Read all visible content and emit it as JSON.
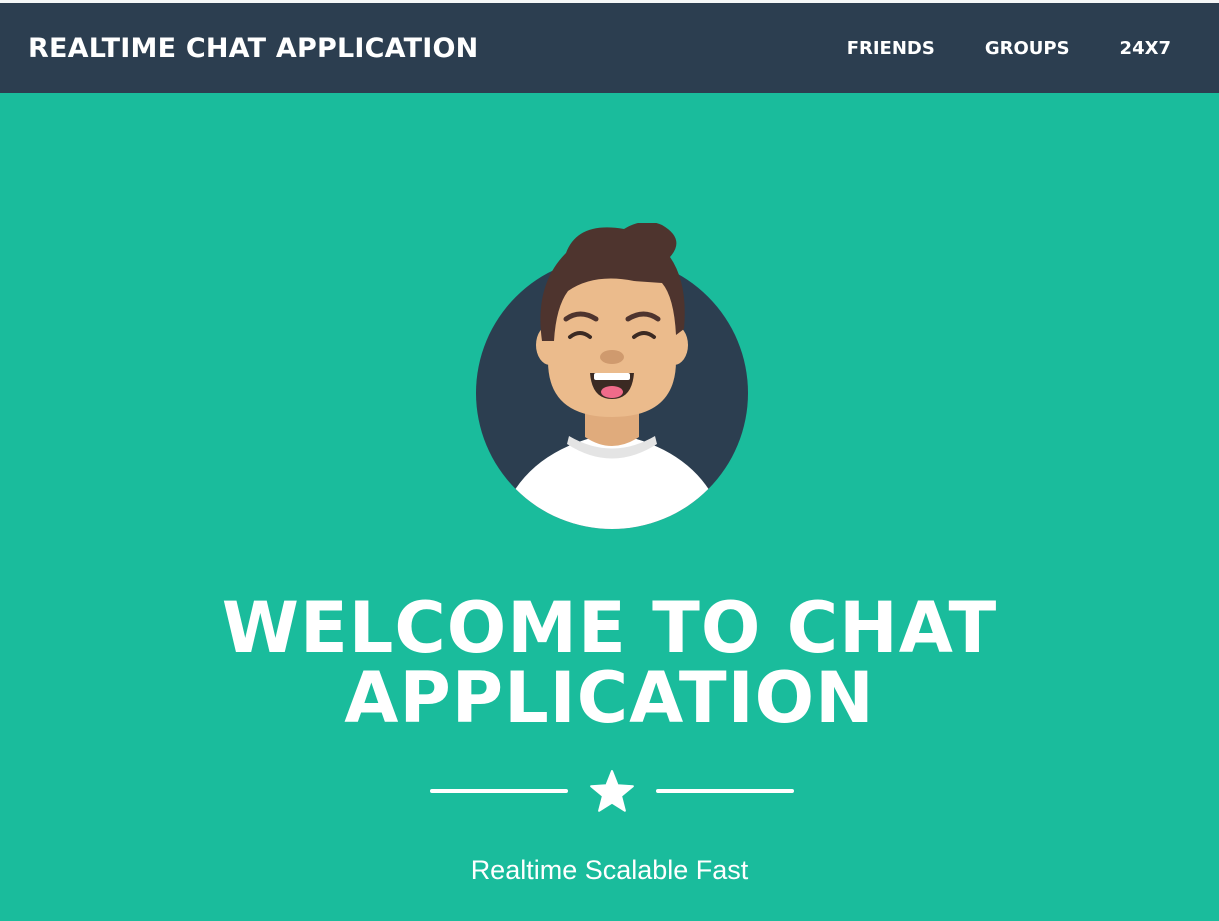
{
  "navbar": {
    "brand": "REALTIME CHAT APPLICATION",
    "links": [
      {
        "label": "FRIENDS"
      },
      {
        "label": "GROUPS"
      },
      {
        "label": "24X7"
      }
    ]
  },
  "hero": {
    "avatar_icon": "smiling-man-avatar-icon",
    "title_line1": "WELCOME TO CHAT",
    "title_line2": "APPLICATION",
    "divider_icon": "star-icon",
    "tagline": "Realtime Scalable Fast"
  },
  "colors": {
    "navbar_bg": "#2c3e50",
    "page_bg": "#1abc9c",
    "text": "#ffffff",
    "avatar_circle": "#2c3e50",
    "hair": "#4e342e",
    "skin": "#ebbb8c",
    "shirt": "#ffffff"
  }
}
